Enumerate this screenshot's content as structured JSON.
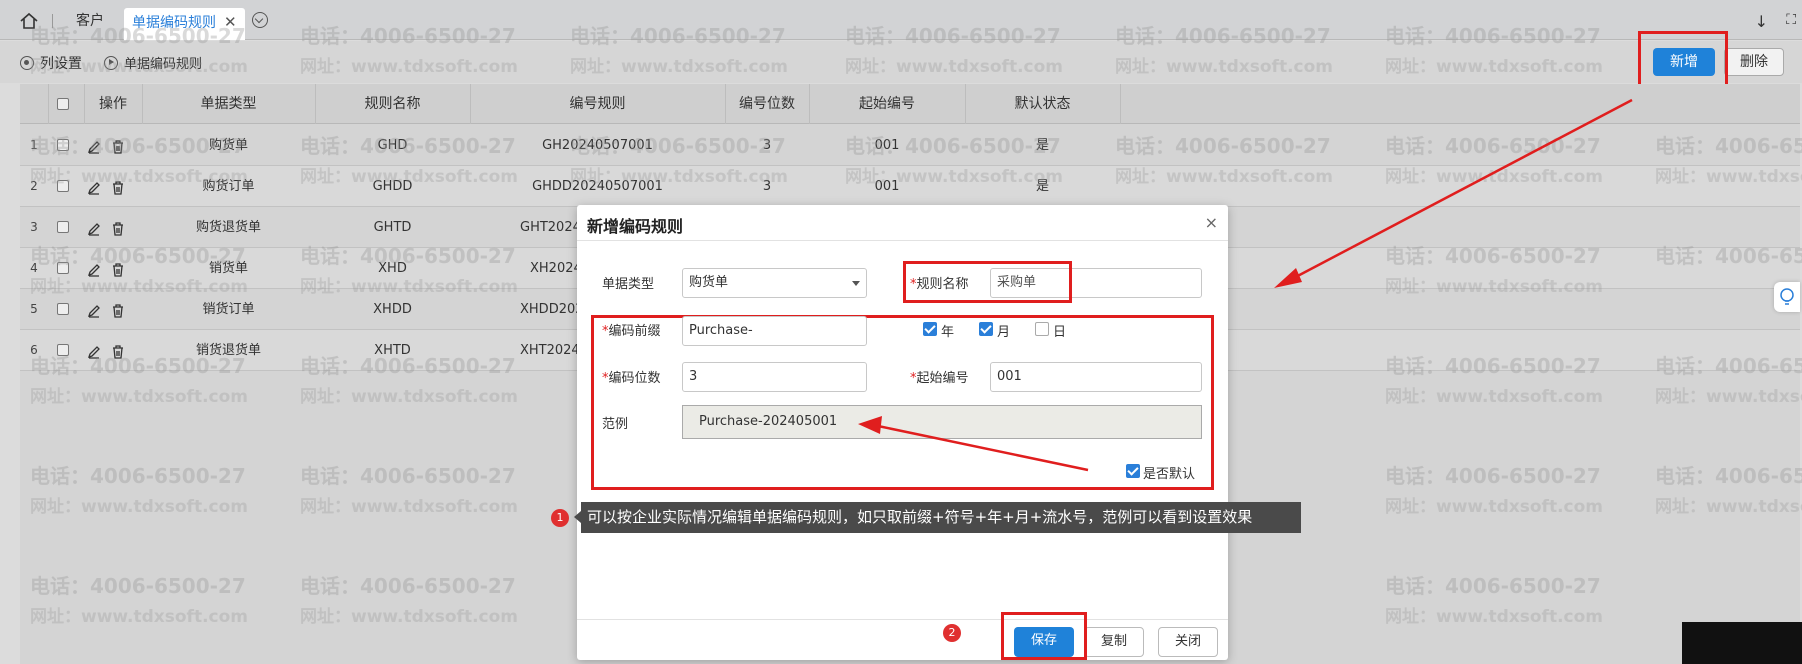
{
  "tabs": {
    "home_icon": "home-icon",
    "tab1": "客户",
    "tab2": "单据编码规则",
    "close_glyph": "✕"
  },
  "toolbar": {
    "column_settings": "列设置",
    "encoding_rule": "单据编码规则",
    "new_label": "新增",
    "delete_label": "删除"
  },
  "table": {
    "headers": [
      "操作",
      "单据类型",
      "规则名称",
      "编号规则",
      "编号位数",
      "起始编号",
      "默认状态"
    ],
    "rows": [
      {
        "no": "1",
        "type": "购货单",
        "name": "GHD",
        "rule": "GH20240507001",
        "digits": "3",
        "start": "001",
        "default": "是"
      },
      {
        "no": "2",
        "type": "购货订单",
        "name": "GHDD",
        "rule": "GHDD20240507001",
        "digits": "3",
        "start": "001",
        "default": "是"
      },
      {
        "no": "3",
        "type": "购货退货单",
        "name": "GHTD",
        "rule": "GHT2024",
        "digits": "",
        "start": "",
        "default": ""
      },
      {
        "no": "4",
        "type": "销货单",
        "name": "XHD",
        "rule": "XH2024",
        "digits": "",
        "start": "",
        "default": ""
      },
      {
        "no": "5",
        "type": "销货订单",
        "name": "XHDD",
        "rule": "XHDD202",
        "digits": "",
        "start": "",
        "default": ""
      },
      {
        "no": "6",
        "type": "销货退货单",
        "name": "XHTD",
        "rule": "XHT2024",
        "digits": "",
        "start": "",
        "default": ""
      }
    ]
  },
  "watermark": {
    "phone": "电话：4006-6500-27",
    "site": "网址：www.tdxsoft.com"
  },
  "dialog": {
    "title": "新增编码规则",
    "close": "×",
    "doc_type_label": "单据类型",
    "doc_type_value": "购货单",
    "rule_name_label": "规则名称",
    "rule_name_value": "采购单",
    "prefix_label": "编码前缀",
    "prefix_value": "Purchase-",
    "year_label": "年",
    "month_label": "月",
    "day_label": "日",
    "year_checked": true,
    "month_checked": true,
    "day_checked": false,
    "digits_label": "编码位数",
    "digits_value": "3",
    "start_label": "起始编号",
    "start_value": "001",
    "example_label": "范例",
    "example_value": "Purchase-202405001",
    "default_label": "是否默认",
    "required_mark": "*",
    "save": "保存",
    "copy": "复制",
    "close_btn": "关闭"
  },
  "annotations": {
    "badge1": "1",
    "badge2": "2",
    "tip": "可以按企业实际情况编辑单据编码规则，如只取前缀+符号+年+月+流水号，范例可以看到设置效果"
  },
  "colors": {
    "accent": "#1f82d9",
    "highlight": "#e01e1e"
  }
}
